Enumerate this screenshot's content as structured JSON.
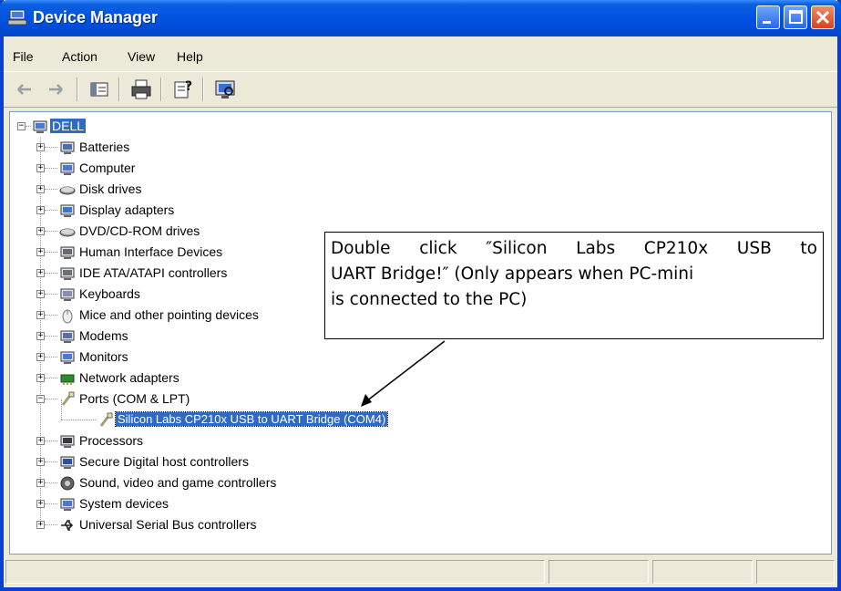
{
  "window": {
    "title": "Device Manager"
  },
  "menu": [
    "File",
    "Action",
    "View",
    "Help"
  ],
  "toolbar": {
    "buttons": [
      "back-icon",
      "forward-icon",
      "show-hide-console-tree-icon",
      "print-icon",
      "properties-help-icon",
      "scan-hardware-icon"
    ]
  },
  "tree": {
    "root": "DELL",
    "items": [
      {
        "label": "Batteries",
        "icon": "battery-icon",
        "expanded": false
      },
      {
        "label": "Computer",
        "icon": "computer-icon",
        "expanded": false
      },
      {
        "label": "Disk drives",
        "icon": "disk-drive-icon",
        "expanded": false
      },
      {
        "label": "Display adapters",
        "icon": "display-adapter-icon",
        "expanded": false
      },
      {
        "label": "DVD/CD-ROM drives",
        "icon": "dvd-drive-icon",
        "expanded": false
      },
      {
        "label": "Human Interface Devices",
        "icon": "hid-icon",
        "expanded": false
      },
      {
        "label": "IDE ATA/ATAPI controllers",
        "icon": "ide-controller-icon",
        "expanded": false
      },
      {
        "label": "Keyboards",
        "icon": "keyboard-icon",
        "expanded": false
      },
      {
        "label": "Mice and other pointing devices",
        "icon": "mouse-icon",
        "expanded": false
      },
      {
        "label": "Modems",
        "icon": "modem-icon",
        "expanded": false
      },
      {
        "label": "Monitors",
        "icon": "monitor-icon",
        "expanded": false
      },
      {
        "label": "Network adapters",
        "icon": "network-adapter-icon",
        "expanded": false
      },
      {
        "label": "Ports (COM & LPT)",
        "icon": "port-icon",
        "expanded": true
      },
      {
        "label": "Silicon Labs CP210x USB to UART Bridge (COM4)",
        "icon": "port-icon",
        "child": true,
        "selected": true
      },
      {
        "label": "Processors",
        "icon": "processor-icon",
        "expanded": false
      },
      {
        "label": "Secure Digital host controllers",
        "icon": "sd-host-icon",
        "expanded": false
      },
      {
        "label": "Sound, video and game controllers",
        "icon": "sound-icon",
        "expanded": false
      },
      {
        "label": "System devices",
        "icon": "system-device-icon",
        "expanded": false
      },
      {
        "label": "Universal Serial Bus controllers",
        "icon": "usb-icon",
        "expanded": false
      }
    ]
  },
  "callout": {
    "lines": [
      "Double click ″Silicon Labs CP210x USB to",
      "UART Bridge!″ (Only appears when PC-mini",
      "is connected to the PC)"
    ]
  },
  "colors": {
    "title_bar": "#0050e0",
    "selection": "#316ac5",
    "window_face": "#ece9d8"
  }
}
